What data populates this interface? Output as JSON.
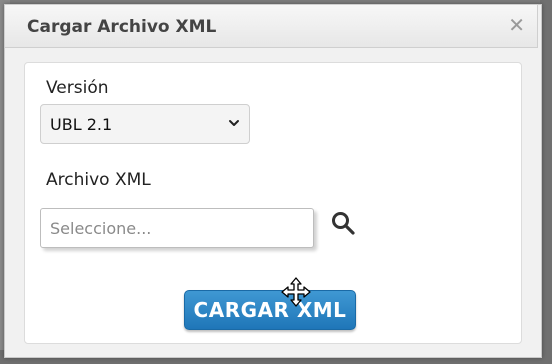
{
  "dialog": {
    "title": "Cargar Archivo XML",
    "close_icon": "close-icon"
  },
  "form": {
    "version_label": "Versión",
    "version_value": "UBL 2.1",
    "file_label": "Archivo XML",
    "file_placeholder": "Seleccione...",
    "search_icon": "search-icon",
    "submit_label": "CARGAR XML"
  },
  "colors": {
    "button_blue": "#2b84c6",
    "header_bg": "#eeeeee"
  }
}
